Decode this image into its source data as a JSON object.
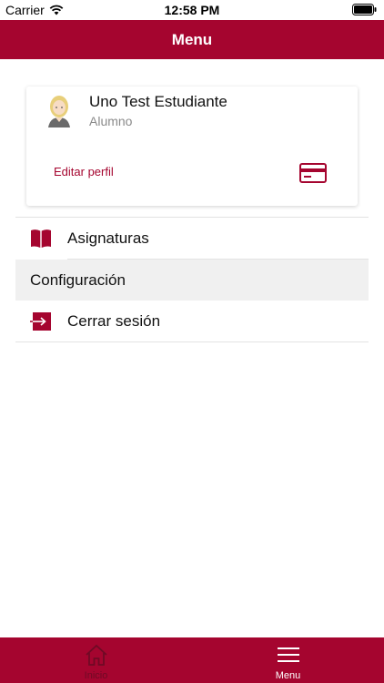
{
  "status_bar": {
    "carrier": "Carrier",
    "time": "12:58 PM"
  },
  "header": {
    "title": "Menu"
  },
  "profile": {
    "name": "Uno Test Estudiante",
    "role": "Alumno",
    "edit_label": "Editar perfil"
  },
  "menu": {
    "asignaturas": "Asignaturas",
    "configuracion": "Configuración",
    "cerrar_sesion": "Cerrar sesión"
  },
  "tabbar": {
    "inicio": "Inicio",
    "menu": "Menu"
  },
  "colors": {
    "brand": "#a5052f",
    "inactive_tab": "#6f0a25"
  },
  "icons": {
    "card": "credit-card-icon",
    "book": "book-icon",
    "logout": "logout-icon",
    "home": "home-icon",
    "hamburger": "hamburger-icon"
  }
}
